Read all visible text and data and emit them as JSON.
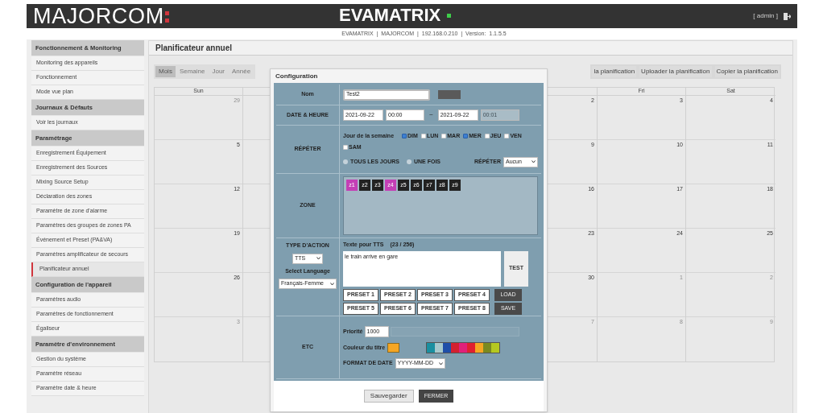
{
  "header": {
    "brand": "MAJORCOM",
    "product": "EVAMATRIX",
    "user": "[ admin ]",
    "info": "EVAMATRIX  |  MAJORCOM  |  192.168.0.210  |  Version:  1.1.5.5"
  },
  "sidebar": [
    {
      "title": "Fonctionnement & Monitoring",
      "items": [
        {
          "label": "Monitoring des appareils",
          "selected": false
        },
        {
          "label": "Fonctionnement",
          "selected": false
        },
        {
          "label": "Mode vue plan",
          "selected": false
        }
      ]
    },
    {
      "title": "Journaux & Défauts",
      "items": [
        {
          "label": "Voir les journaux",
          "selected": false
        }
      ]
    },
    {
      "title": "Paramétrage",
      "items": [
        {
          "label": "Enregistrement Équipement",
          "selected": false
        },
        {
          "label": "Enregistrement des Sources",
          "selected": false
        },
        {
          "label": "Mixing Source Setup",
          "selected": false
        },
        {
          "label": "Déclaration des zones",
          "selected": false
        },
        {
          "label": "Paramètre de zone d'alarme",
          "selected": false
        },
        {
          "label": "Paramètres des groupes de zones PA",
          "selected": false
        },
        {
          "label": "Événement et Preset (PA&VA)",
          "selected": false
        },
        {
          "label": "Paramètres amplificateur de secours",
          "selected": false
        },
        {
          "label": "Planificateur annuel",
          "selected": true
        }
      ]
    },
    {
      "title": "Configuration de l'appareil",
      "items": [
        {
          "label": "Paramètres audio",
          "selected": false
        },
        {
          "label": "Paramètres de fonctionnement",
          "selected": false
        },
        {
          "label": "Égaliseur",
          "selected": false
        }
      ]
    },
    {
      "title": "Paramètre d'environnement",
      "items": [
        {
          "label": "Gestion du système",
          "selected": false
        },
        {
          "label": "Paramètre réseau",
          "selected": false
        },
        {
          "label": "Paramètre date & heure",
          "selected": false
        }
      ]
    }
  ],
  "page_title": "Planificateur annuel",
  "view_tabs": [
    {
      "label": "Mois",
      "selected": true
    },
    {
      "label": "Semaine",
      "selected": false
    },
    {
      "label": "Jour",
      "selected": false
    },
    {
      "label": "Année",
      "selected": false
    }
  ],
  "actions": [
    "la planification",
    "Uploader la planification",
    "Copier la planification"
  ],
  "calendar": {
    "columns": [
      {
        "header": "Sun",
        "days": [
          {
            "day": "29",
            "muted": true
          },
          {
            "day": "5",
            "muted": false
          },
          {
            "day": "12",
            "muted": false
          },
          {
            "day": "19",
            "muted": false
          },
          {
            "day": "26",
            "muted": false
          },
          {
            "day": "3",
            "muted": true
          }
        ]
      },
      {
        "days": [
          {
            "day": "2",
            "muted": false
          },
          {
            "day": "9",
            "muted": false
          },
          {
            "day": "16",
            "muted": false
          },
          {
            "day": "23",
            "muted": false
          },
          {
            "day": "30",
            "muted": false
          },
          {
            "day": "7",
            "muted": true
          }
        ]
      },
      {
        "header": "Fri",
        "days": [
          {
            "day": "3",
            "muted": false
          },
          {
            "day": "10",
            "muted": false
          },
          {
            "day": "17",
            "muted": false
          },
          {
            "day": "24",
            "muted": false
          },
          {
            "day": "1",
            "muted": true
          },
          {
            "day": "8",
            "muted": true
          }
        ]
      },
      {
        "header": "Sat",
        "days": [
          {
            "day": "4",
            "muted": false
          },
          {
            "day": "11",
            "muted": false
          },
          {
            "day": "18",
            "muted": false
          },
          {
            "day": "25",
            "muted": false
          },
          {
            "day": "2",
            "muted": true
          },
          {
            "day": "9",
            "muted": true
          }
        ]
      }
    ]
  },
  "dialog": {
    "title": "Configuration",
    "name": {
      "label": "Nom",
      "value": "Test2"
    },
    "datetime": {
      "label": "DATE & HEURE",
      "start_date": "2021-09-22",
      "start_time": "00:00",
      "separator": "~",
      "end_date": "2021-09-22",
      "end_time": "00:01"
    },
    "repeat": {
      "label": "RÉPÉTER",
      "weekday_label": "Jour de la semaine",
      "weekdays": [
        {
          "label": "DIM",
          "checked": true
        },
        {
          "label": "LUN",
          "checked": false
        },
        {
          "label": "MAR",
          "checked": false
        },
        {
          "label": "MER",
          "checked": true
        },
        {
          "label": "JEU",
          "checked": false
        },
        {
          "label": "VEN",
          "checked": false
        },
        {
          "label": "SAM",
          "checked": false
        }
      ],
      "modes": [
        {
          "label": "TOUS LES JOURS",
          "selected": false
        },
        {
          "label": "UNE FOIS",
          "selected": false
        }
      ],
      "repeat_label": "RÉPÉTER",
      "repeat_value": "Aucun"
    },
    "zone": {
      "label": "ZONE",
      "zones": [
        {
          "label": "z1",
          "selected": true
        },
        {
          "label": "z2",
          "selected": false
        },
        {
          "label": "z3",
          "selected": false
        },
        {
          "label": "z4",
          "selected": true
        },
        {
          "label": "z5",
          "selected": false
        },
        {
          "label": "z6",
          "selected": false
        },
        {
          "label": "z7",
          "selected": false
        },
        {
          "label": "z8",
          "selected": false
        },
        {
          "label": "z9",
          "selected": false
        }
      ]
    },
    "action": {
      "label": "TYPE D'ACTION",
      "type": "TTS",
      "language_label": "Select Language",
      "language": "Français-Femme",
      "tts_label": "Texte pour TTS",
      "tts_count": "(23 / 256)",
      "tts_text": "le train arrive en gare",
      "test": "TEST",
      "presets": [
        "PRESET 1",
        "PRESET 2",
        "PRESET 3",
        "PRESET 4",
        "PRESET 5",
        "PRESET 6",
        "PRESET 7",
        "PRESET 8"
      ],
      "load": "LOAD",
      "save": "SAVE"
    },
    "etc": {
      "label": "ETC",
      "priority_label": "Priorité",
      "priority": "1000",
      "title_color_label": "Couleur du titre",
      "palette": [
        {
          "color": "#1a8fa0"
        },
        {
          "color": "#a6c8cc"
        },
        {
          "color": "#1f4fa8"
        },
        {
          "color": "#d42030"
        },
        {
          "color": "#e0207a"
        },
        {
          "color": "#e02030"
        },
        {
          "color": "#f5a623"
        },
        {
          "color": "#7a8a20"
        },
        {
          "color": "#b5c820"
        }
      ],
      "date_format_label": "FORMAT DE DATE",
      "date_format": "YYYY-MM-DD"
    },
    "buttons": [
      "Sauvegarder",
      "FERMER"
    ]
  }
}
